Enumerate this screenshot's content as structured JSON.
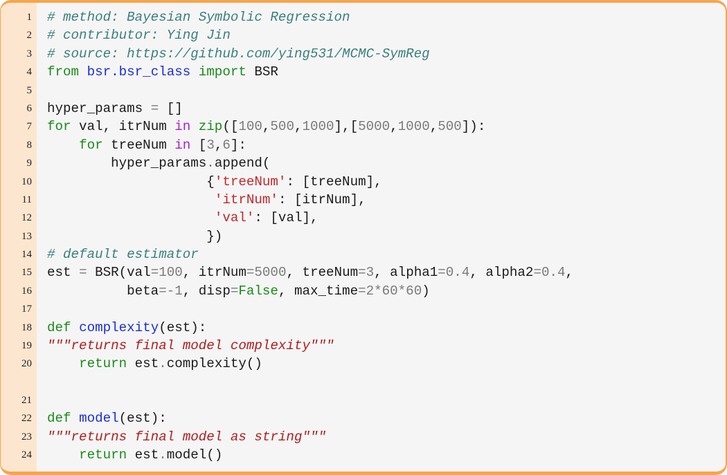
{
  "document": {
    "type": "code-listing",
    "language": "python",
    "colors": {
      "frame_border": "#f7a54c",
      "gutter_background": "#fde6d0",
      "code_background": "#f5f5f5",
      "comment": "#3b7f80",
      "keyword": "#1a8a1a",
      "operator_keyword": "#b020d0",
      "function_name": "#1a2fd6",
      "number": "#7a7a7a",
      "string": "#c0282c",
      "docstring": "#b01e1e"
    },
    "lines": [
      {
        "number": "1",
        "tokens": [
          {
            "t": "comment",
            "v": "# method: Bayesian Symbolic Regression"
          }
        ]
      },
      {
        "number": "2",
        "tokens": [
          {
            "t": "comment",
            "v": "# contributor: Ying Jin"
          }
        ]
      },
      {
        "number": "3",
        "tokens": [
          {
            "t": "comment",
            "v": "# source: https://github.com/ying531/MCMC-SymReg"
          }
        ]
      },
      {
        "number": "4",
        "tokens": [
          {
            "t": "kw",
            "v": "from"
          },
          {
            "t": "plain",
            "v": " "
          },
          {
            "t": "name",
            "v": "bsr.bsr_class"
          },
          {
            "t": "plain",
            "v": " "
          },
          {
            "t": "kw",
            "v": "import"
          },
          {
            "t": "plain",
            "v": " BSR"
          }
        ]
      },
      {
        "number": "5",
        "tokens": []
      },
      {
        "number": "6",
        "tokens": [
          {
            "t": "plain",
            "v": "hyper_params "
          },
          {
            "t": "op",
            "v": "="
          },
          {
            "t": "plain",
            "v": " []"
          }
        ]
      },
      {
        "number": "7",
        "tokens": [
          {
            "t": "kw",
            "v": "for"
          },
          {
            "t": "plain",
            "v": " val, itrNum "
          },
          {
            "t": "in",
            "v": "in"
          },
          {
            "t": "plain",
            "v": " "
          },
          {
            "t": "kw",
            "v": "zip"
          },
          {
            "t": "plain",
            "v": "(["
          },
          {
            "t": "num",
            "v": "100"
          },
          {
            "t": "plain",
            "v": ","
          },
          {
            "t": "num",
            "v": "500"
          },
          {
            "t": "plain",
            "v": ","
          },
          {
            "t": "num",
            "v": "1000"
          },
          {
            "t": "plain",
            "v": "],["
          },
          {
            "t": "num",
            "v": "5000"
          },
          {
            "t": "plain",
            "v": ","
          },
          {
            "t": "num",
            "v": "1000"
          },
          {
            "t": "plain",
            "v": ","
          },
          {
            "t": "num",
            "v": "500"
          },
          {
            "t": "plain",
            "v": "]):"
          }
        ]
      },
      {
        "number": "8",
        "tokens": [
          {
            "t": "plain",
            "v": "    "
          },
          {
            "t": "kw",
            "v": "for"
          },
          {
            "t": "plain",
            "v": " treeNum "
          },
          {
            "t": "in",
            "v": "in"
          },
          {
            "t": "plain",
            "v": " ["
          },
          {
            "t": "num",
            "v": "3"
          },
          {
            "t": "plain",
            "v": ","
          },
          {
            "t": "num",
            "v": "6"
          },
          {
            "t": "plain",
            "v": "]:"
          }
        ]
      },
      {
        "number": "9",
        "tokens": [
          {
            "t": "plain",
            "v": "        hyper_params"
          },
          {
            "t": "op",
            "v": "."
          },
          {
            "t": "plain",
            "v": "append("
          }
        ]
      },
      {
        "number": "10",
        "tokens": [
          {
            "t": "plain",
            "v": "                    {"
          },
          {
            "t": "str",
            "v": "'treeNum'"
          },
          {
            "t": "plain",
            "v": ": [treeNum],"
          }
        ]
      },
      {
        "number": "11",
        "tokens": [
          {
            "t": "plain",
            "v": "                     "
          },
          {
            "t": "str",
            "v": "'itrNum'"
          },
          {
            "t": "plain",
            "v": ": [itrNum],"
          }
        ]
      },
      {
        "number": "12",
        "tokens": [
          {
            "t": "plain",
            "v": "                     "
          },
          {
            "t": "str",
            "v": "'val'"
          },
          {
            "t": "plain",
            "v": ": [val],"
          }
        ]
      },
      {
        "number": "13",
        "tokens": [
          {
            "t": "plain",
            "v": "                    })"
          }
        ]
      },
      {
        "number": "14",
        "tokens": [
          {
            "t": "comment",
            "v": "# default estimator"
          }
        ]
      },
      {
        "number": "15",
        "tokens": [
          {
            "t": "plain",
            "v": "est "
          },
          {
            "t": "op",
            "v": "="
          },
          {
            "t": "plain",
            "v": " BSR(val"
          },
          {
            "t": "op",
            "v": "="
          },
          {
            "t": "num",
            "v": "100"
          },
          {
            "t": "plain",
            "v": ", itrNum"
          },
          {
            "t": "op",
            "v": "="
          },
          {
            "t": "num",
            "v": "5000"
          },
          {
            "t": "plain",
            "v": ", treeNum"
          },
          {
            "t": "op",
            "v": "="
          },
          {
            "t": "num",
            "v": "3"
          },
          {
            "t": "plain",
            "v": ", alpha1"
          },
          {
            "t": "op",
            "v": "="
          },
          {
            "t": "num",
            "v": "0.4"
          },
          {
            "t": "plain",
            "v": ", alpha2"
          },
          {
            "t": "op",
            "v": "="
          },
          {
            "t": "num",
            "v": "0.4"
          },
          {
            "t": "plain",
            "v": ","
          }
        ]
      },
      {
        "number": "16",
        "tokens": [
          {
            "t": "plain",
            "v": "          beta"
          },
          {
            "t": "op",
            "v": "="
          },
          {
            "t": "num",
            "v": "-1"
          },
          {
            "t": "plain",
            "v": ", disp"
          },
          {
            "t": "op",
            "v": "="
          },
          {
            "t": "kw",
            "v": "False"
          },
          {
            "t": "plain",
            "v": ", max_time"
          },
          {
            "t": "op",
            "v": "="
          },
          {
            "t": "num",
            "v": "2*60*60"
          },
          {
            "t": "plain",
            "v": ")"
          }
        ]
      },
      {
        "number": "17",
        "tokens": []
      },
      {
        "number": "18",
        "tokens": [
          {
            "t": "kw",
            "v": "def"
          },
          {
            "t": "plain",
            "v": " "
          },
          {
            "t": "name",
            "v": "complexity"
          },
          {
            "t": "plain",
            "v": "(est):"
          }
        ]
      },
      {
        "number": "19",
        "tokens": [
          {
            "t": "doc",
            "v": "\"\"\"returns final model complexity\"\"\""
          }
        ]
      },
      {
        "number": "20",
        "tokens": [
          {
            "t": "plain",
            "v": "    "
          },
          {
            "t": "kw",
            "v": "return"
          },
          {
            "t": "plain",
            "v": " est"
          },
          {
            "t": "op",
            "v": "."
          },
          {
            "t": "plain",
            "v": "complexity()"
          }
        ]
      },
      {
        "number": "21",
        "gap_before": true,
        "tokens": []
      },
      {
        "number": "22",
        "tokens": [
          {
            "t": "kw",
            "v": "def"
          },
          {
            "t": "plain",
            "v": " "
          },
          {
            "t": "name",
            "v": "model"
          },
          {
            "t": "plain",
            "v": "(est):"
          }
        ]
      },
      {
        "number": "23",
        "tokens": [
          {
            "t": "doc",
            "v": "\"\"\"returns final model as string\"\"\""
          }
        ]
      },
      {
        "number": "24",
        "tokens": [
          {
            "t": "plain",
            "v": "    "
          },
          {
            "t": "kw",
            "v": "return"
          },
          {
            "t": "plain",
            "v": " est"
          },
          {
            "t": "op",
            "v": "."
          },
          {
            "t": "plain",
            "v": "model()"
          }
        ]
      }
    ]
  }
}
